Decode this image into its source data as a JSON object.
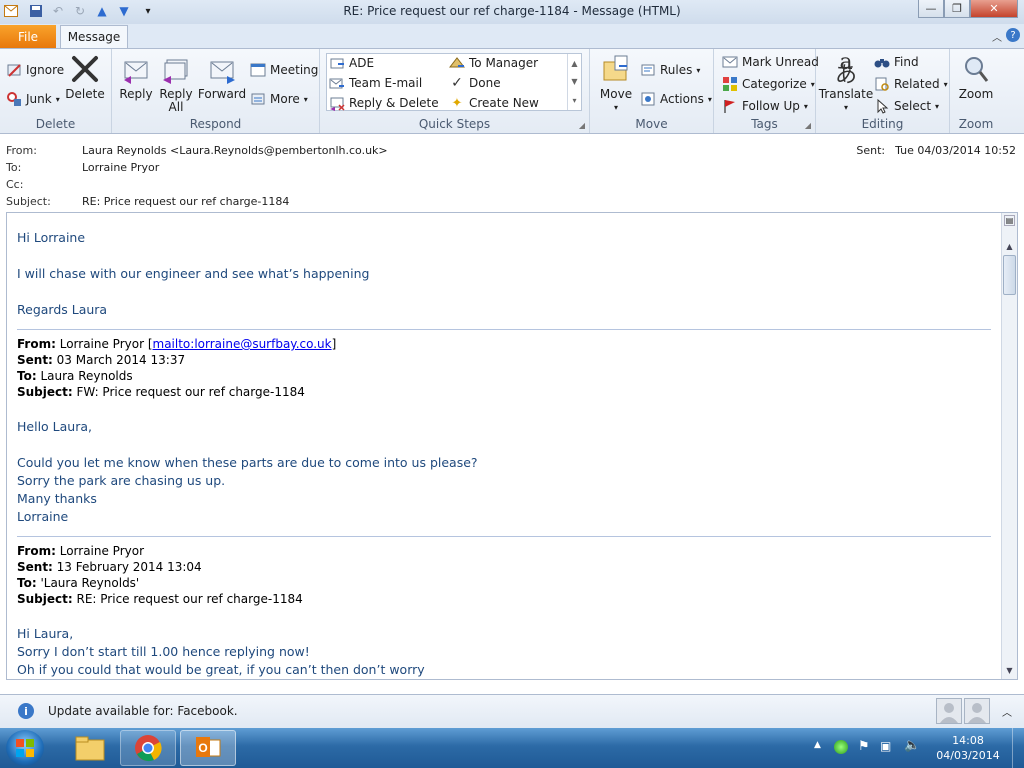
{
  "window": {
    "title": "RE: Price request our ref charge-1184  -  Message (HTML)"
  },
  "tabs": [
    {
      "label": "File"
    },
    {
      "label": "Message"
    }
  ],
  "ribbon": {
    "delete_group": {
      "label": "Delete",
      "ignore": "Ignore",
      "junk": "Junk",
      "delete": "Delete"
    },
    "respond_group": {
      "label": "Respond",
      "reply": "Reply",
      "reply_all": "Reply All",
      "reply_all_1": "Reply",
      "reply_all_2": "All",
      "forward": "Forward",
      "meeting": "Meeting",
      "more": "More"
    },
    "quick_steps_group": {
      "label": "Quick Steps",
      "items": [
        "ADE",
        "To Manager",
        "Team E-mail",
        "Done",
        "Reply & Delete",
        "Create New"
      ]
    },
    "move_group": {
      "label": "Move",
      "move": "Move",
      "rules": "Rules",
      "actions": "Actions"
    },
    "tags_group": {
      "label": "Tags",
      "mark_unread": "Mark Unread",
      "categorize": "Categorize",
      "follow_up": "Follow Up"
    },
    "editing_group": {
      "label": "Editing",
      "translate": "Translate",
      "find": "Find",
      "related": "Related",
      "select": "Select"
    },
    "zoom_group": {
      "label": "Zoom",
      "zoom": "Zoom"
    }
  },
  "header": {
    "from_label": "From:",
    "from": "Laura Reynolds <Laura.Reynolds@pembertonlh.co.uk>",
    "to_label": "To:",
    "to": "Lorraine Pryor",
    "cc_label": "Cc:",
    "subject_label": "Subject:",
    "subject": "RE: Price request our ref charge-1184",
    "sent_label": "Sent:",
    "sent": "Tue 04/03/2014 10:52"
  },
  "message": {
    "greeting": "Hi Lorraine",
    "line1": "I will chase with our engineer and see what’s happening",
    "signoff": "Regards Laura",
    "quote1": {
      "from_label": "From:",
      "from_name": " Lorraine Pryor [",
      "from_link": "mailto:lorraine@surfbay.co.uk",
      "from_end": "]",
      "sent_label": "Sent:",
      "sent": " 03 March 2014 13:37",
      "to_label": "To:",
      "to": " Laura Reynolds",
      "subject_label": "Subject:",
      "subject": " FW: Price request our ref charge-1184",
      "greeting": "Hello Laura,",
      "line1": "Could you let me know when these parts are due to come into us please?",
      "line2": "Sorry the park are chasing us up.",
      "line3": "Many thanks",
      "line4": "Lorraine"
    },
    "quote2": {
      "from_label": "From:",
      "from": " Lorraine Pryor",
      "sent_label": "Sent:",
      "sent": " 13 February 2014 13:04",
      "to_label": "To:",
      "to": " 'Laura Reynolds'",
      "subject_label": "Subject:",
      "subject": " RE: Price request our ref charge-1184",
      "greeting": "Hi Laura,",
      "line1": "Sorry I don’t start till 1.00 hence replying now!",
      "line2": "Oh if you could that would be great, if you can’t then don’t worry"
    }
  },
  "status_bar": {
    "text": "Update available for: Facebook."
  },
  "taskbar": {
    "time": "14:08",
    "date": "04/03/2014"
  },
  "colors": {
    "accent_file_tab": "#e8780c",
    "body_text": "#1f497d",
    "taskbar": "#2c6aa6"
  }
}
